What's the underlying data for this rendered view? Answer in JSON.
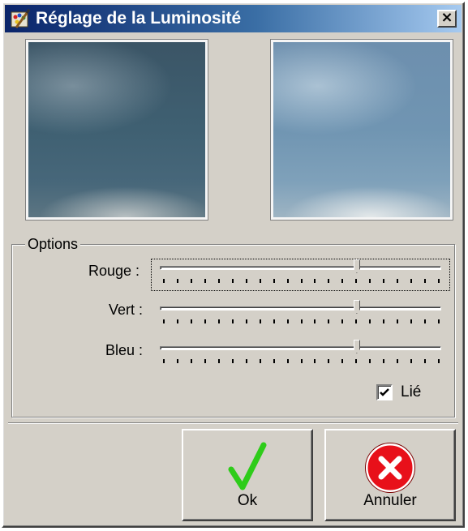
{
  "window": {
    "title": "Réglage de la Luminosité",
    "close_glyph": "×"
  },
  "icons": {
    "title": "paint-palette-icon",
    "close": "close-icon",
    "ok": "green-check-icon",
    "cancel": "red-x-circle-icon"
  },
  "options": {
    "group_label": "Options",
    "sliders": [
      {
        "label": "Rouge :",
        "value_fraction": 0.7,
        "focused": true
      },
      {
        "label": "Vert :",
        "value_fraction": 0.7,
        "focused": false
      },
      {
        "label": "Bleu :",
        "value_fraction": 0.7,
        "focused": false
      }
    ],
    "tick_count": 21,
    "linked": {
      "label": "Lié",
      "checked": true
    }
  },
  "buttons": {
    "ok": "Ok",
    "cancel": "Annuler"
  },
  "colors": {
    "check_green": "#2ecc1a",
    "cancel_red": "#e8101a"
  }
}
